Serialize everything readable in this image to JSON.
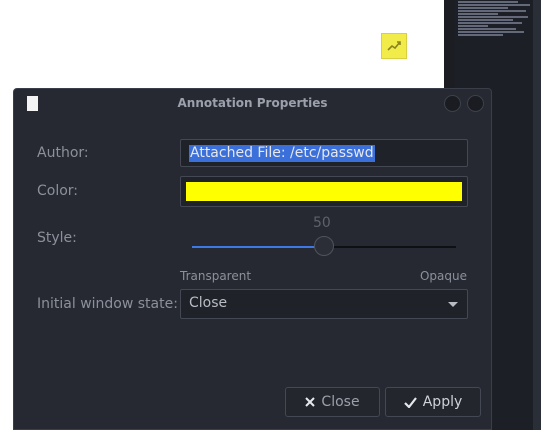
{
  "dialog": {
    "title": "Annotation Properties",
    "labels": {
      "author": "Author:",
      "color": "Color:",
      "style": "Style:",
      "initial_state": "Initial window state:"
    },
    "author_value": "Attached File: /etc/passwd",
    "color_value": "#ffff00",
    "slider": {
      "value": "50",
      "value_fraction": 0.5,
      "min_label": "Transparent",
      "max_label": "Opaque"
    },
    "initial_state_value": "Close",
    "buttons": {
      "close": "Close",
      "apply": "Apply"
    }
  },
  "icons": {
    "titlebar": "window-icon",
    "note": "annotation-note-icon",
    "close_button": "close-x-icon",
    "apply_button": "checkmark-icon",
    "combo": "chevron-down-icon"
  },
  "colors": {
    "dialog_bg": "#262932",
    "selection": "#3b6fd9",
    "slider_fill": "#3d78e6",
    "note": "#f2ec4a"
  }
}
